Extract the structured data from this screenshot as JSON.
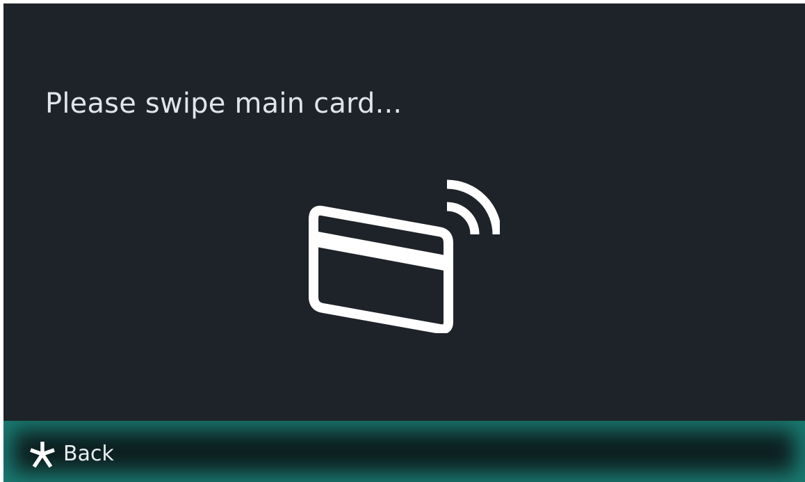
{
  "screen": {
    "prompt_text": "Please swipe main card...",
    "icon": "contactless-card-icon"
  },
  "bottom_bar": {
    "back_label": "Back",
    "back_icon": "asterisk-icon"
  },
  "colors": {
    "background": "#1e2329",
    "text": "#dfe6ea",
    "accent_glow": "#1c8c80"
  }
}
